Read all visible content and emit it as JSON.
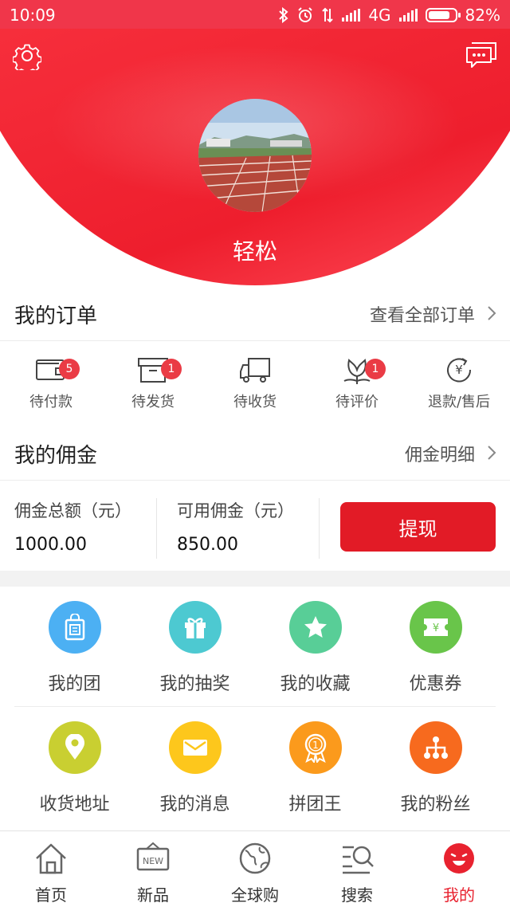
{
  "status_bar": {
    "time": "10:09",
    "network": "4G",
    "battery": "82%",
    "battery_level": 0.82
  },
  "profile": {
    "username": "轻松"
  },
  "icons": {
    "settings": "gear-icon",
    "messages": "chat-bubble-icon"
  },
  "orders": {
    "title": "我的订单",
    "view_all": "查看全部订单",
    "items": [
      {
        "label": "待付款",
        "badge": "5",
        "icon": "wallet-icon"
      },
      {
        "label": "待发货",
        "badge": "1",
        "icon": "box-icon"
      },
      {
        "label": "待收货",
        "badge": "",
        "icon": "truck-icon"
      },
      {
        "label": "待评价",
        "badge": "1",
        "icon": "flower-icon"
      },
      {
        "label": "退款/售后",
        "badge": "",
        "icon": "refund-icon"
      }
    ]
  },
  "commission": {
    "title": "我的佣金",
    "detail": "佣金明细",
    "total_label": "佣金总额（元）",
    "total_value": "1000.00",
    "available_label": "可用佣金（元）",
    "available_value": "850.00",
    "withdraw": "提现"
  },
  "menu": [
    {
      "label": "我的团",
      "icon": "group-bag-icon",
      "color": "#4cb0f3"
    },
    {
      "label": "我的抽奖",
      "icon": "gift-icon",
      "color": "#4dc9d1"
    },
    {
      "label": "我的收藏",
      "icon": "star-icon",
      "color": "#58ce97"
    },
    {
      "label": "优惠券",
      "icon": "coupon-icon",
      "color": "#69c54a"
    },
    {
      "label": "收货地址",
      "icon": "location-pin-icon",
      "color": "#c9cf31"
    },
    {
      "label": "我的消息",
      "icon": "envelope-icon",
      "color": "#fdc71c"
    },
    {
      "label": "拼团王",
      "icon": "medal-icon",
      "color": "#fb9a1c"
    },
    {
      "label": "我的粉丝",
      "icon": "network-icon",
      "color": "#f76a1e"
    }
  ],
  "tabs": [
    {
      "label": "首页",
      "icon": "home-icon",
      "active": false
    },
    {
      "label": "新品",
      "icon": "new-sign-icon",
      "active": false,
      "icon_text": "NEW"
    },
    {
      "label": "全球购",
      "icon": "globe-icon",
      "active": false
    },
    {
      "label": "搜索",
      "icon": "search-icon",
      "active": false
    },
    {
      "label": "我的",
      "icon": "smiley-icon",
      "active": true
    }
  ],
  "colors": {
    "brand_red": "#e8222f",
    "status_bar": "#f0364a",
    "badge": "#ea3b45"
  }
}
